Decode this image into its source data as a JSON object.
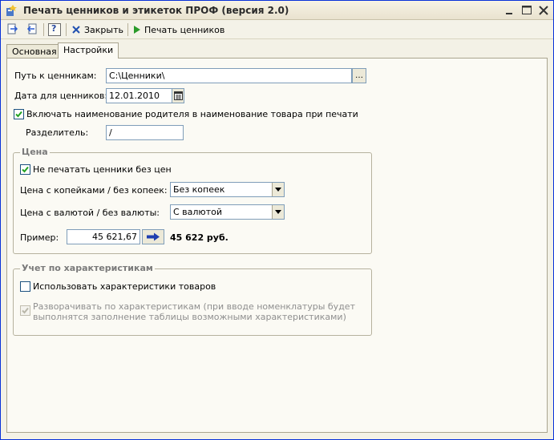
{
  "window": {
    "title": "Печать ценников и этикеток ПРОФ (версия 2.0)"
  },
  "toolbar": {
    "close_label": "Закрыть",
    "print_label": "Печать ценников",
    "help_label": "?"
  },
  "tabs": [
    {
      "label": "Основная",
      "active": false
    },
    {
      "label": "Настройки",
      "active": true
    }
  ],
  "settings": {
    "path_label": "Путь к ценникам:",
    "path_value": "C:\\Ценники\\",
    "date_label": "Дата для ценников:",
    "date_value": "12.01.2010",
    "include_parent_label": "Включать наименование родителя в наименование товара при печати",
    "include_parent_checked": true,
    "separator_label": "Разделитель:",
    "separator_value": "/"
  },
  "price_group": {
    "title": "Цена",
    "no_print_label": "Не печатать ценники без цен",
    "no_print_checked": true,
    "kopecks_label": "Цена с копейками / без копеек:",
    "kopecks_value": "Без копеек",
    "currency_label": "Цена с валютой / без валюты:",
    "currency_value": "С валютой",
    "example_label": "Пример:",
    "example_input": "45 621,67",
    "example_result": "45 622 руб."
  },
  "characteristics_group": {
    "title": "Учет по характеристикам",
    "use_label": "Использовать характеристики товаров",
    "use_checked": false,
    "expand_label_line1": "Разворачивать по характеристикам (при вводе номенклатуры будет",
    "expand_label_line2": "выполнятся заполнение таблицы возможными характеристиками)",
    "expand_checked": true,
    "expand_disabled": true
  },
  "colors": {
    "title_bar": "#ece9d8",
    "accent_blue": "#0831d9",
    "panel_bg": "#fbfaf4"
  }
}
